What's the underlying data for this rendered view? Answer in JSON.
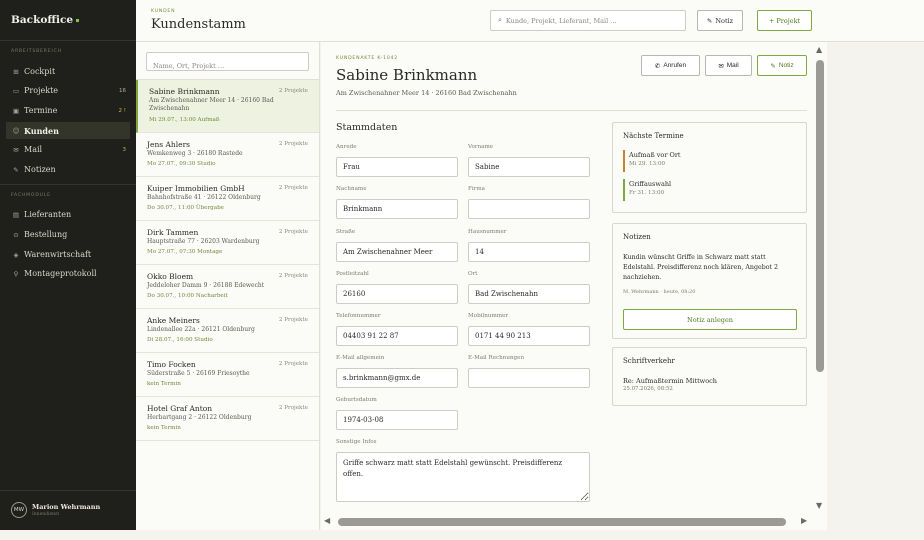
{
  "sidebar": {
    "brand": "Backoffice",
    "section_work": "ARBEITSBEREICH",
    "section_modules": "FACHMODULE",
    "items": [
      {
        "label": "Cockpit",
        "badge": "",
        "icon": "grid-icon"
      },
      {
        "label": "Projekte",
        "badge": "16",
        "icon": "folder-icon"
      },
      {
        "label": "Termine",
        "badge": "2 !",
        "icon": "calendar-icon"
      },
      {
        "label": "Kunden",
        "badge": "",
        "icon": "users-icon"
      },
      {
        "label": "Mail",
        "badge": "3",
        "icon": "mail-icon"
      },
      {
        "label": "Notizen",
        "badge": "",
        "icon": "note-icon"
      }
    ],
    "modules": [
      {
        "label": "Lieferanten",
        "icon": "truck-icon"
      },
      {
        "label": "Bestellung",
        "icon": "cart-icon"
      },
      {
        "label": "Warenwirtschaft",
        "icon": "box-icon"
      },
      {
        "label": "Montageprotokoll",
        "icon": "wrench-icon"
      }
    ],
    "user": {
      "initials": "MW",
      "name": "Marion Wehrmann",
      "role": "Innendienst"
    }
  },
  "header": {
    "crumb": "KUNDEN",
    "title": "Kundenstamm",
    "search_placeholder": "Kunde, Projekt, Lieferant, Mail …",
    "notiz_label": "Notiz",
    "projekt_label": "+ Projekt"
  },
  "list": {
    "search_placeholder": "Name, Ort, Projekt …",
    "customers": [
      {
        "name": "Sabine Brinkmann",
        "address": "Am Zwischenahner Meer 14 · 26160 Bad Zwischenahn",
        "next": "Mi 29.07., 13:00 Aufmaß",
        "projects": "2 Projekte"
      },
      {
        "name": "Jens Ahlers",
        "address": "Wemkenweg 3 · 26180 Rastede",
        "next": "Mo 27.07., 09:30 Studio",
        "projects": "2 Projekte"
      },
      {
        "name": "Kuiper Immobilien GmbH",
        "address": "Bahnhofstraße 41 · 26122 Oldenburg",
        "next": "Do 30.07., 11:00 Übergabe",
        "projects": "2 Projekte"
      },
      {
        "name": "Dirk Tammen",
        "address": "Hauptstraße 77 · 26203 Wardenburg",
        "next": "Mo 27.07., 07:30 Montage",
        "projects": "2 Projekte"
      },
      {
        "name": "Okko Bloem",
        "address": "Jeddeloher Damm 9 · 26188 Edewecht",
        "next": "Do 30.07., 10:00 Nacharbeit",
        "projects": "2 Projekte"
      },
      {
        "name": "Anke Meiners",
        "address": "Lindenallee 22a · 26121 Oldenburg",
        "next": "Di 28.07., 16:00 Studio",
        "projects": "2 Projekte"
      },
      {
        "name": "Timo Focken",
        "address": "Süderstraße 5 · 26169 Friesoythe",
        "next": "kein Termin",
        "projects": "2 Projekte"
      },
      {
        "name": "Hotel Graf Anton",
        "address": "Herbartgang 2 · 26122 Oldenburg",
        "next": "kein Termin",
        "projects": "2 Projekte"
      }
    ]
  },
  "detail": {
    "kicker": "KUNDENAKTE K-1042",
    "title": "Sabine Brinkmann",
    "subtitle": "Am Zwischenahner Meer 14 · 26160 Bad Zwischenahn",
    "btn_call": "Anrufen",
    "btn_mail": "Mail",
    "btn_notiz": "Notiz",
    "section": "Stammdaten",
    "fields": {
      "anrede": {
        "label": "Anrede",
        "value": "Frau"
      },
      "vorname": {
        "label": "Vorname",
        "value": "Sabine"
      },
      "nachname": {
        "label": "Nachname",
        "value": "Brinkmann"
      },
      "firma": {
        "label": "Firma",
        "value": ""
      },
      "strasse": {
        "label": "Straße",
        "value": "Am Zwischenahner Meer"
      },
      "hausnummer": {
        "label": "Hausnummer",
        "value": "14"
      },
      "plz": {
        "label": "Postleitzahl",
        "value": "26160"
      },
      "ort": {
        "label": "Ort",
        "value": "Bad Zwischenahn"
      },
      "telefon": {
        "label": "Telefonnummer",
        "value": "04403 91 22 87"
      },
      "mobil": {
        "label": "Mobilnummer",
        "value": "0171 44 90 213"
      },
      "email": {
        "label": "E-Mail allgemein",
        "value": "s.brinkmann@gmx.de"
      },
      "email_rechnung": {
        "label": "E-Mail Rechnungen",
        "value": ""
      },
      "geburtsdatum": {
        "label": "Geburtsdatum",
        "value": "1974-03-08"
      },
      "sonstiges": {
        "label": "Sonstige Infos",
        "value": "Griffe schwarz matt statt Edelstahl gewünscht. Preisdifferenz offen."
      }
    },
    "termine": {
      "title": "Nächste Termine",
      "items": [
        {
          "title": "Aufmaß vor Ort",
          "time": "Mi 29. 13:00",
          "color": "#c9832a"
        },
        {
          "title": "Griffauswahl",
          "time": "Fr 31. 13:00",
          "color": "#7ea93e"
        }
      ]
    },
    "notizen": {
      "title": "Notizen",
      "text": "Kundin wünscht Griffe in Schwarz matt statt Edelstahl. Preisdifferenz noch klären, Angebot 2 nachziehen.",
      "meta": "M. Wehrmann · heute, 08:20",
      "button": "Notiz anlegen"
    },
    "schrift": {
      "title": "Schriftverkehr",
      "subject": "Re: Aufmaßtermin Mittwoch",
      "date": "25.07.2026, 08:52"
    }
  },
  "colors": {
    "accent": "#7ea93e",
    "sidebar_bg": "#1f1f1b",
    "warning": "#c9832a"
  }
}
